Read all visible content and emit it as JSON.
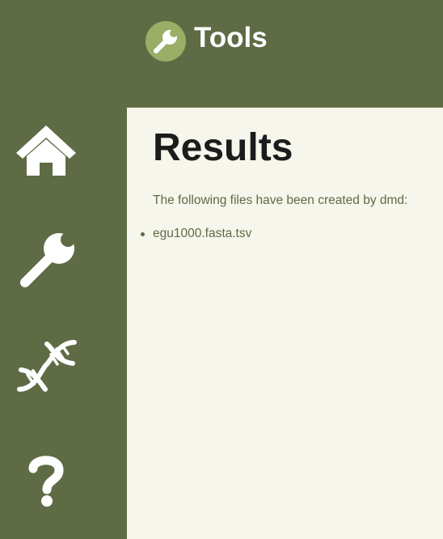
{
  "header": {
    "logo_icon": "wrench-icon",
    "title": "Tools"
  },
  "sidebar": {
    "items": [
      {
        "id": "home",
        "icon": "home-icon"
      },
      {
        "id": "tools",
        "icon": "wrench-icon"
      },
      {
        "id": "dna",
        "icon": "dna-icon"
      },
      {
        "id": "help",
        "icon": "question-mark-icon"
      }
    ]
  },
  "main": {
    "title": "Results",
    "intro": "The following files have been created by dmd:",
    "files": [
      "egu1000.fasta.tsv"
    ]
  },
  "colors": {
    "sidebar_bg": "#5f6b45",
    "content_bg": "#f6f6ec",
    "logo_bg": "#9aae66",
    "text_accent": "#5f6b45"
  }
}
